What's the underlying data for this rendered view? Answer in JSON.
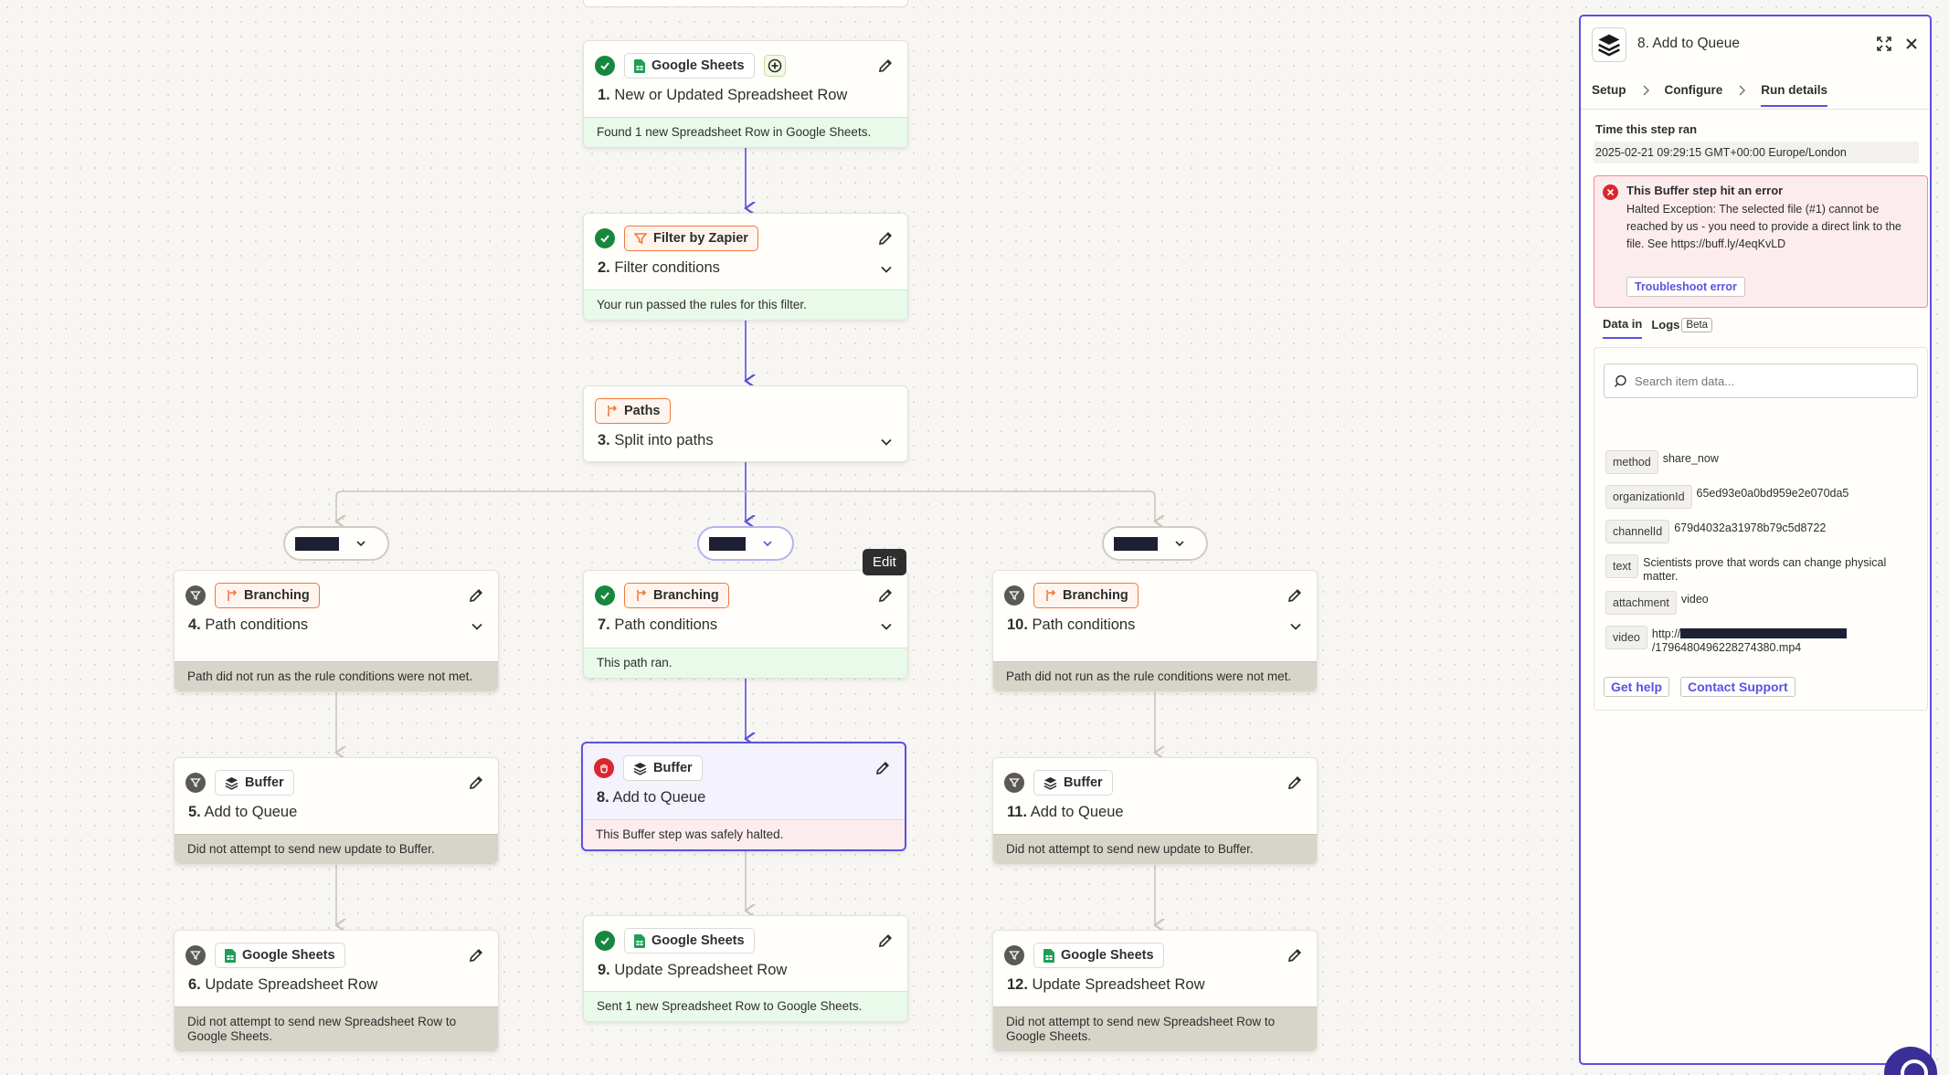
{
  "colors": {
    "accent": "#5b51e0",
    "success": "#16883d",
    "halt": "#d8272f",
    "skipped": "#5a5955",
    "zapier_orange": "#f07a3a"
  },
  "tooltip": "Edit",
  "steps": {
    "s1": {
      "app": "Google Sheets",
      "num": "1.",
      "title": "New or Updated Spreadsheet Row",
      "status": "Found 1 new Spreadsheet Row in Google Sheets."
    },
    "s2": {
      "app": "Filter by Zapier",
      "num": "2.",
      "title": "Filter conditions",
      "status": "Your run passed the rules for this filter."
    },
    "s3": {
      "app": "Paths",
      "num": "3.",
      "title": "Split into paths"
    },
    "s4": {
      "app": "Branching",
      "num": "4.",
      "title": "Path conditions",
      "status": "Path did not run as the rule conditions were not met."
    },
    "s5": {
      "app": "Buffer",
      "num": "5.",
      "title": "Add to Queue",
      "status": "Did not attempt to send new update to Buffer."
    },
    "s6": {
      "app": "Google Sheets",
      "num": "6.",
      "title": "Update Spreadsheet Row",
      "status": "Did not attempt to send new Spreadsheet Row to Google Sheets."
    },
    "s7": {
      "app": "Branching",
      "num": "7.",
      "title": "Path conditions",
      "status": "This path ran."
    },
    "s8": {
      "app": "Buffer",
      "num": "8.",
      "title": "Add to Queue",
      "status": "This Buffer step was safely halted."
    },
    "s9": {
      "app": "Google Sheets",
      "num": "9.",
      "title": "Update Spreadsheet Row",
      "status": "Sent 1 new Spreadsheet Row to Google Sheets."
    },
    "s10": {
      "app": "Branching",
      "num": "10.",
      "title": "Path conditions",
      "status": "Path did not run as the rule conditions were not met."
    },
    "s11": {
      "app": "Buffer",
      "num": "11.",
      "title": "Add to Queue",
      "status": "Did not attempt to send new update to Buffer."
    },
    "s12": {
      "app": "Google Sheets",
      "num": "12.",
      "title": "Update Spreadsheet Row",
      "status": "Did not attempt to send new Spreadsheet Row to Google Sheets."
    }
  },
  "panel": {
    "title": "8. Add to Queue",
    "tabs": [
      "Setup",
      "Configure",
      "Run details"
    ],
    "time_label": "Time this step ran",
    "time_value": "2025-02-21 09:29:15 GMT+00:00 Europe/London",
    "error_title": "This Buffer step hit an error",
    "error_message": "Halted Exception: The selected file (#1) cannot be reached by us - you need to provide a direct link to the file. See https://buff.ly/4eqKvLD",
    "troubleshoot": "Troubleshoot error",
    "subtabs": {
      "data_in": "Data in",
      "logs": "Logs",
      "beta": "Beta"
    },
    "search_placeholder": "Search item data...",
    "data": [
      {
        "key": "method",
        "value": "share_now"
      },
      {
        "key": "organizationId",
        "value": "65ed93e0a0bd959e2e070da5"
      },
      {
        "key": "channelId",
        "value": "679d4032a31978b79c5d8722"
      },
      {
        "key": "text",
        "value": "Scientists prove that words can change physical matter."
      },
      {
        "key": "attachment",
        "value": "video"
      },
      {
        "key": "video",
        "value_prefix": "http://",
        "value_suffix": "/1796480496228274380.mp4"
      }
    ],
    "get_help": "Get help",
    "contact_support": "Contact Support"
  }
}
